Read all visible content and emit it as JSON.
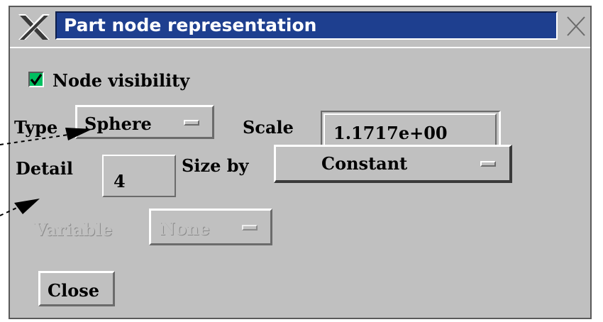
{
  "window": {
    "title": "Part node representation"
  },
  "node_visibility": {
    "label": "Node visibility",
    "checked": true
  },
  "type": {
    "label": "Type",
    "value": "Sphere"
  },
  "scale": {
    "label": "Scale",
    "value": "1.1717e+00"
  },
  "detail": {
    "label": "Detail",
    "value": "4"
  },
  "size_by": {
    "label": "Size by",
    "value": "Constant"
  },
  "variable": {
    "label": "Variable",
    "value": "None",
    "enabled": false
  },
  "close_button": {
    "label": "Close"
  },
  "colors": {
    "title_bar": "#1e3f8f",
    "checkbox": "#00c060",
    "panel": "#c0c0c0"
  }
}
